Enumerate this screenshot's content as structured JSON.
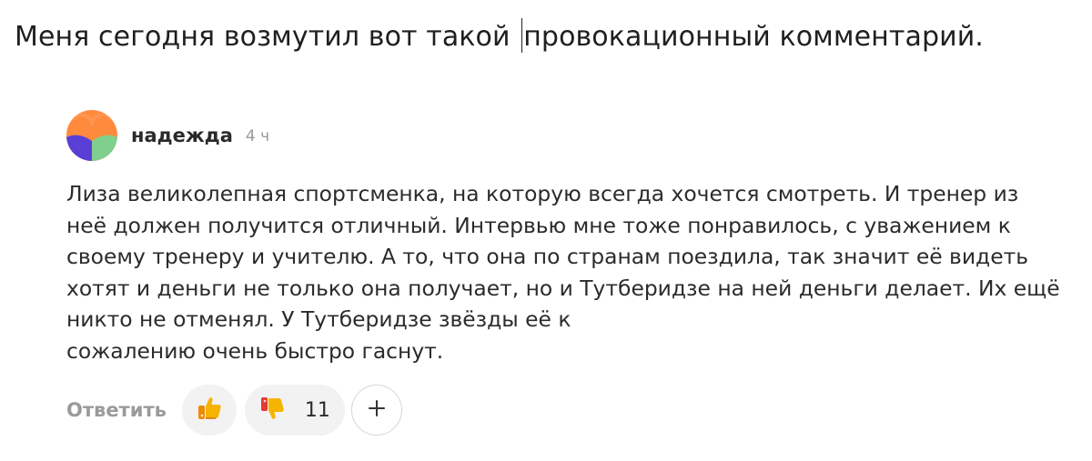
{
  "post": {
    "headline_part1": "Меня сегодня возмутил вот такой ",
    "headline_part2": "провокационный комментарий."
  },
  "comment": {
    "author": "надежда",
    "time": "4 ч",
    "lines": [
      "Лиза великолепная спортсменка, на которую всегда хочется смотреть. И тренер из",
      "неё должен получится отличный. Интервью мне тоже понравилось, с уважением к",
      "своему тренеру и учителю. А то, что она по странам поездила, так значит её видеть",
      "хотят и деньги не только она получает, но и Тутберидзе на ней деньги делает. Их ещё",
      "никто не отменял. У Тутберидзе звёзды её к",
      "сожалению очень быстро гаснут."
    ],
    "avatar_colors": {
      "top": "#ff8a3d",
      "bottom_left": "#5a3fd6",
      "bottom_right": "#7fd08c"
    }
  },
  "actions": {
    "reply_label": "Ответить",
    "like_icon": "thumbs-up-icon",
    "dislike_icon": "thumbs-down-icon",
    "dislike_count": "11",
    "add_icon": "plus-icon",
    "add_label": "+"
  }
}
